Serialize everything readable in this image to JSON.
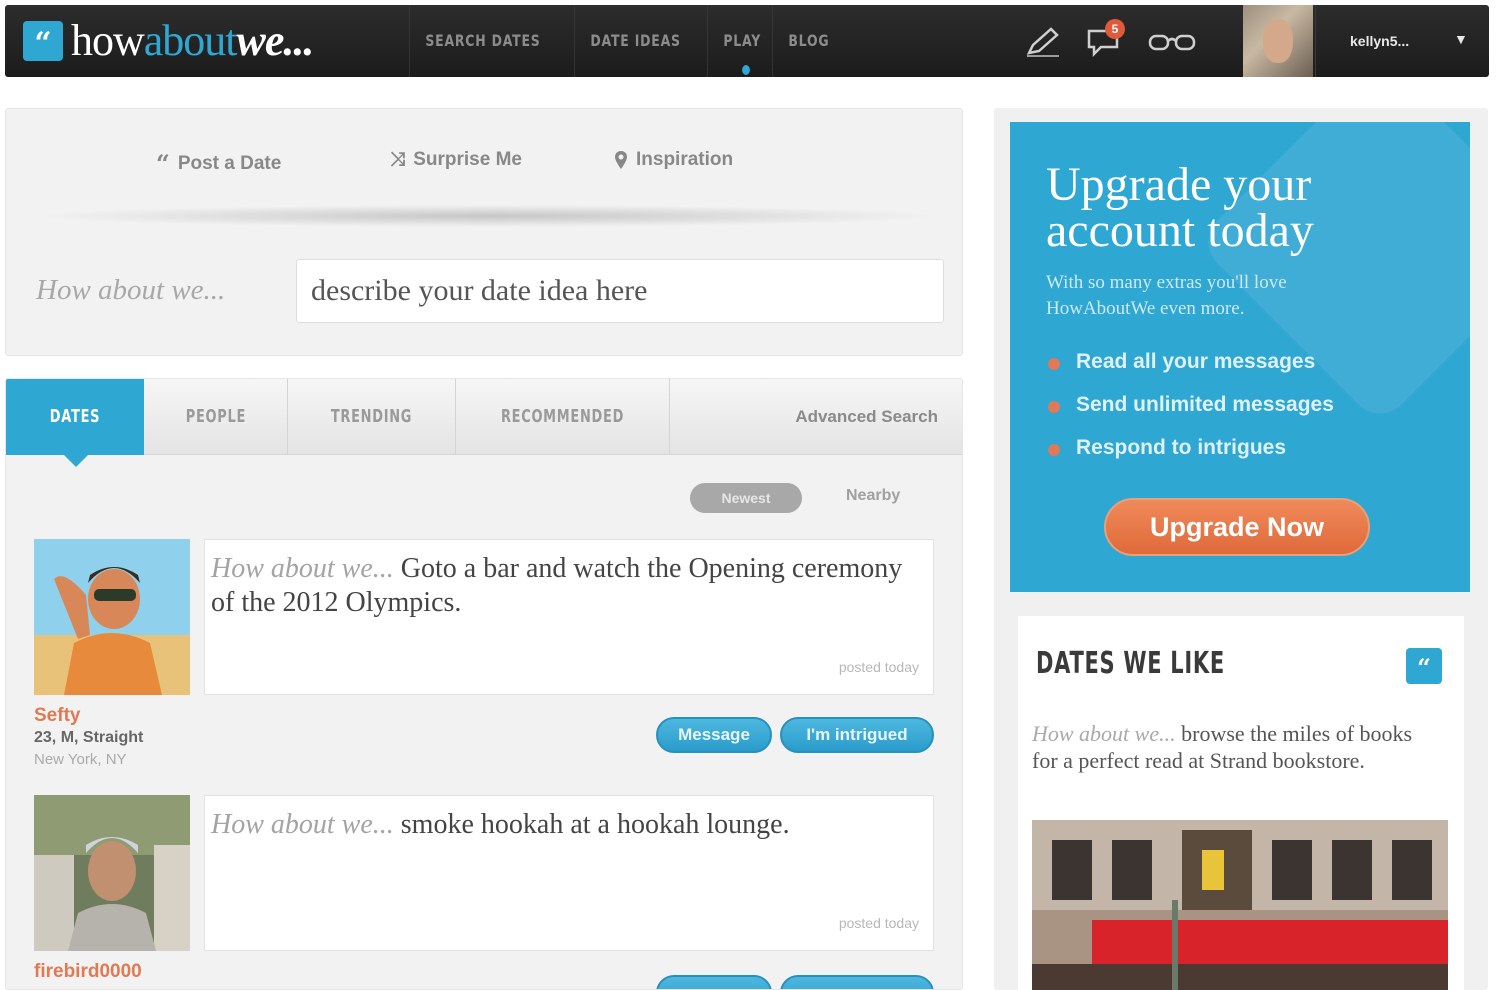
{
  "logo": {
    "badge": "“",
    "how": "how",
    "about": "about",
    "we": "we..."
  },
  "topnav": [
    "SEARCH DATES",
    "DATE IDEAS",
    "PLAY",
    "BLOG"
  ],
  "notifications": {
    "count": "5"
  },
  "user": {
    "name": "kellyn5..."
  },
  "post_actions": {
    "post": "Post a Date",
    "surprise": "Surprise Me",
    "inspiration": "Inspiration"
  },
  "idea": {
    "label": "How about we...",
    "placeholder": "describe your date idea here"
  },
  "tabs": [
    "DATES",
    "PEOPLE",
    "TRENDING",
    "RECOMMENDED"
  ],
  "advanced_search": "Advanced Search",
  "sort": {
    "active": "Newest",
    "other": "Nearby"
  },
  "dates": [
    {
      "prefix": "How about we...",
      "text": "Goto a bar and watch the Opening ceremony of the 2012 Olympics.",
      "posted": "posted today",
      "name": "Sefty",
      "meta": "23, M, Straight",
      "location": "New York, NY",
      "message": "Message",
      "intrigued": "I'm intrigued"
    },
    {
      "prefix": "How about we...",
      "text": "smoke hookah at a hookah lounge.",
      "posted": "posted today",
      "name": "firebird0000"
    }
  ],
  "upgrade": {
    "title": "Upgrade your account today",
    "subtitle": "With so many extras you'll love HowAboutWe even more.",
    "items": [
      "Read all your messages",
      "Send unlimited messages",
      "Respond to intrigues"
    ],
    "button": "Upgrade Now"
  },
  "dates_we_like": {
    "title": "DATES WE LIKE",
    "badge": "“",
    "prefix": "How about we...",
    "text": "browse the miles of books for a perfect read at Strand bookstore."
  },
  "colors": {
    "accent": "#2fa7d3",
    "orange": "#e0785a",
    "topbar": "#222222"
  }
}
